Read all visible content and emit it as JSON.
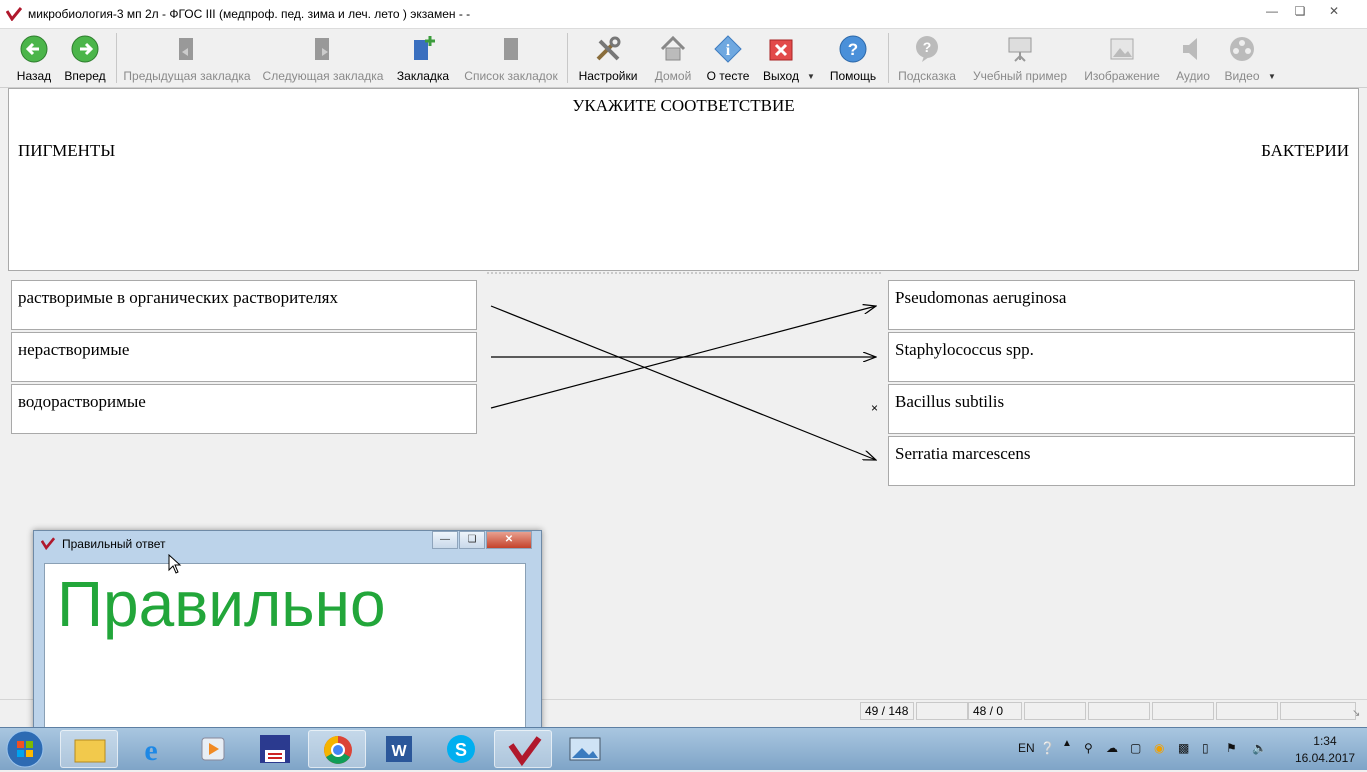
{
  "window": {
    "title": "микробиология-3 мп 2л - ФГОС III (медпроф. пед. зима и леч. лето ) экзамен -  -",
    "minimize_icon": "minimize-icon",
    "maximize_icon": "maximize-icon",
    "close_icon": "close-icon"
  },
  "toolbar": {
    "back": "Назад",
    "forward": "Вперед",
    "prev_bookmark": "Предыдущая закладка",
    "next_bookmark": "Следующая закладка",
    "bookmark": "Закладка",
    "bookmark_list": "Список закладок",
    "settings": "Настройки",
    "home": "Домой",
    "about": "О тесте",
    "exit": "Выход",
    "help": "Помощь",
    "hint": "Подсказка",
    "example": "Учебный пример",
    "image": "Изображение",
    "audio": "Аудио",
    "video": "Видео"
  },
  "question": {
    "title": "УКАЖИТЕ СООТВЕТСТВИЕ",
    "left_header": "ПИГМЕНТЫ",
    "right_header": "БАКТЕРИИ"
  },
  "left_items": [
    "растворимые в органических растворителях",
    "нерастворимые",
    "водорастворимые"
  ],
  "right_items": [
    "Pseudomonas aeruginosa",
    "Staphylococcus spp.",
    "Bacillus subtilis",
    "Serratia marcescens"
  ],
  "unmatched_marker": "×",
  "statusbar": {
    "progress": "49 / 148",
    "score": "48 / 0"
  },
  "popup": {
    "title": "Правильный ответ",
    "message": "Правильно",
    "message_color": "#22a63a"
  },
  "taskbar": {
    "language": "EN",
    "time": "1:34",
    "date": "16.04.2017"
  }
}
